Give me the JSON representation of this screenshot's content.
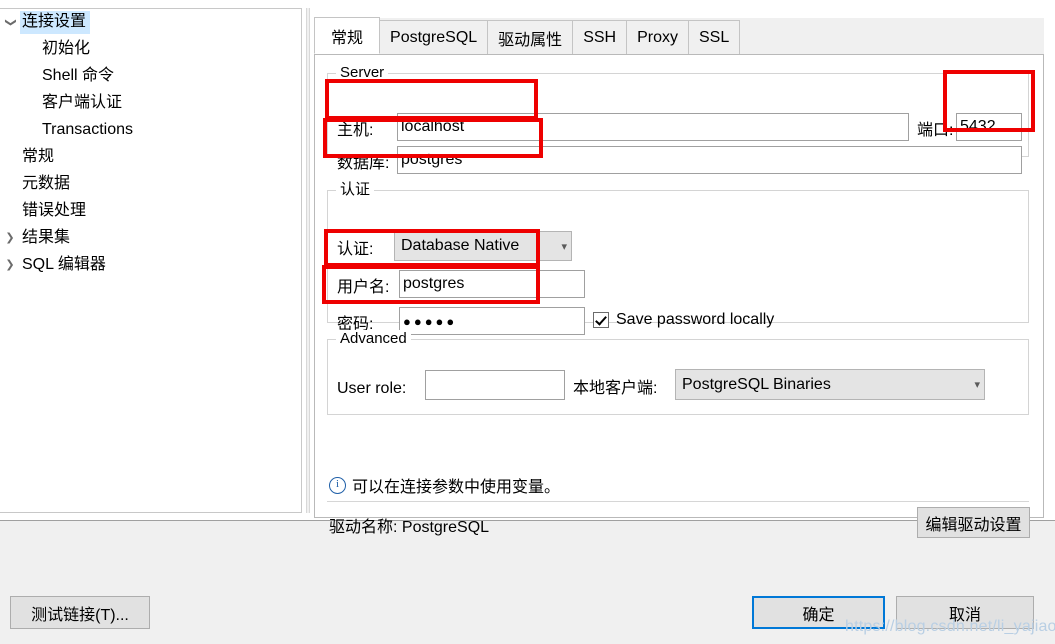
{
  "sidebar": {
    "items": [
      {
        "label": "连接设置",
        "level": 0,
        "expanded": true,
        "arrow": "chevron-down-icon",
        "selected": true
      },
      {
        "label": "初始化",
        "level": 1,
        "expanded": false,
        "arrow": "none",
        "selected": false
      },
      {
        "label": "Shell 命令",
        "level": 1,
        "expanded": false,
        "arrow": "none",
        "selected": false
      },
      {
        "label": "客户端认证",
        "level": 1,
        "expanded": false,
        "arrow": "none",
        "selected": false
      },
      {
        "label": "Transactions",
        "level": 1,
        "expanded": false,
        "arrow": "none",
        "selected": false
      },
      {
        "label": "常规",
        "level": 0,
        "expanded": false,
        "arrow": "none",
        "selected": false
      },
      {
        "label": "元数据",
        "level": 0,
        "expanded": false,
        "arrow": "none",
        "selected": false
      },
      {
        "label": "错误处理",
        "level": 0,
        "expanded": false,
        "arrow": "none",
        "selected": false
      },
      {
        "label": "结果集",
        "level": 0,
        "expanded": false,
        "arrow": "chevron-right-icon",
        "selected": false
      },
      {
        "label": "SQL 编辑器",
        "level": 0,
        "expanded": false,
        "arrow": "chevron-right-icon",
        "selected": false
      }
    ]
  },
  "tabs": [
    {
      "label": "常规",
      "active": true
    },
    {
      "label": "PostgreSQL",
      "active": false
    },
    {
      "label": "驱动属性",
      "active": false
    },
    {
      "label": "SSH",
      "active": false
    },
    {
      "label": "Proxy",
      "active": false
    },
    {
      "label": "SSL",
      "active": false
    }
  ],
  "server_group": {
    "title": "Server",
    "host_label": "主机:",
    "host_value": "localhost",
    "port_label": "端口:",
    "port_value": "5432",
    "database_label": "数据库:",
    "database_value": "postgres"
  },
  "auth_group": {
    "title": "认证",
    "auth_label": "认证:",
    "auth_value": "Database Native",
    "username_label": "用户名:",
    "username_value": "postgres",
    "password_label": "密码:",
    "password_value": "●●●●●",
    "save_password_label": "Save password locally",
    "save_password_checked": true
  },
  "advanced_group": {
    "title": "Advanced",
    "user_role_label": "User role:",
    "user_role_value": "",
    "local_client_label": "本地客户端:",
    "local_client_value": "PostgreSQL Binaries"
  },
  "info": {
    "icon": "info-icon",
    "text": "可以在连接参数中使用变量。"
  },
  "driver": {
    "label": "驱动名称: PostgreSQL",
    "edit_button": "编辑驱动设置"
  },
  "footer": {
    "test_connection": "测试链接(T)...",
    "ok": "确定",
    "cancel": "取消"
  },
  "watermark": "https://blog.csdn.net/li_yajiao",
  "colors": {
    "accent": "#0078d7",
    "annotation": "#ee0000",
    "selection": "#cde8ff",
    "info": "#2060a8"
  }
}
